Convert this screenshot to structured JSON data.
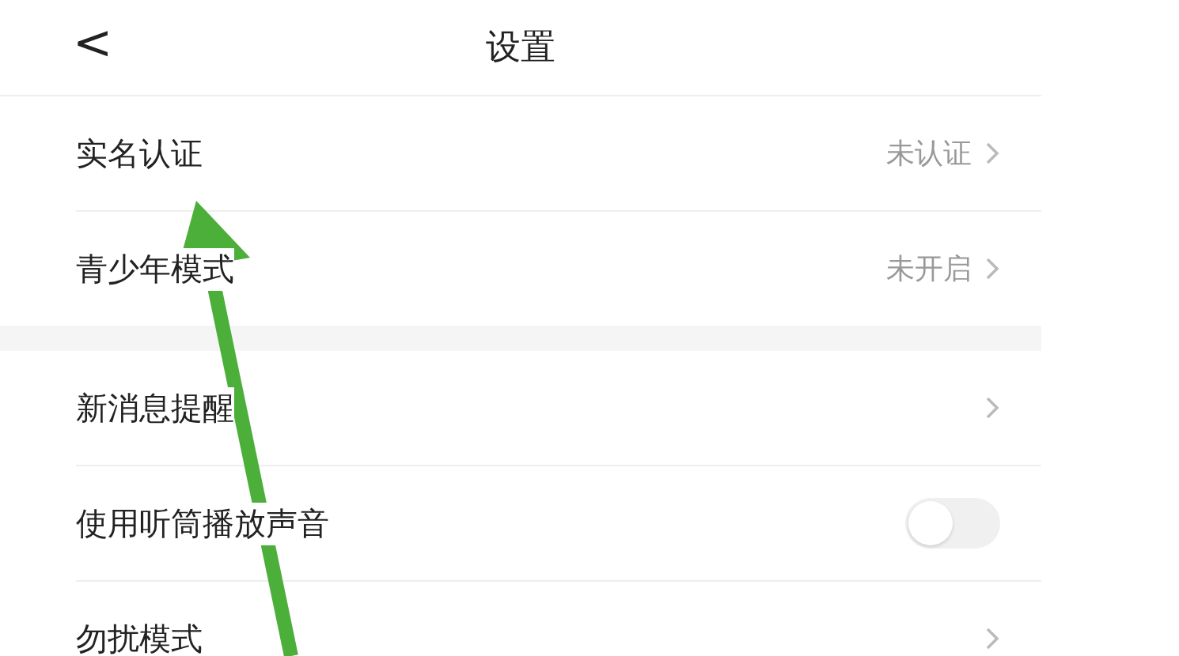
{
  "header": {
    "back": "<",
    "title": "设置"
  },
  "groups": [
    {
      "items": [
        {
          "kind": "link",
          "label": "实名认证",
          "value": "未认证"
        },
        {
          "kind": "link",
          "label": "青少年模式",
          "value": "未开启"
        }
      ]
    },
    {
      "items": [
        {
          "kind": "link",
          "label": "新消息提醒"
        },
        {
          "kind": "toggle",
          "label": "使用听筒播放声音",
          "on": false
        },
        {
          "kind": "link",
          "label": "勿扰模式"
        }
      ]
    }
  ]
}
